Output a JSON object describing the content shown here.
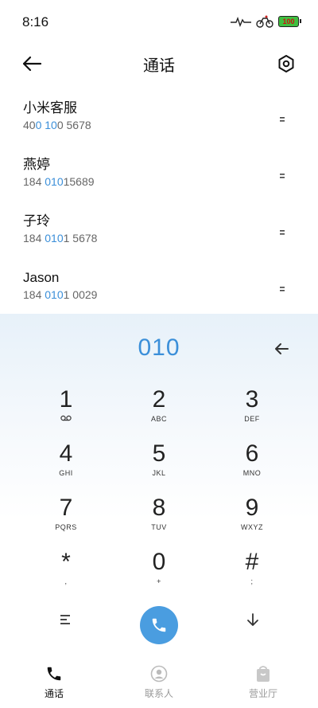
{
  "status_bar": {
    "time": "8:16",
    "battery_level": "100"
  },
  "header": {
    "title": "通话"
  },
  "contacts": [
    {
      "name": "小米客服",
      "number_pre": "40",
      "number_match": "0 10",
      "number_post": "0 5678"
    },
    {
      "name": "燕婷",
      "number_pre": "184 ",
      "number_match": "010",
      "number_post": "15689"
    },
    {
      "name": "子玲",
      "number_pre": "184 ",
      "number_match": "010",
      "number_post": "1 5678"
    },
    {
      "name": "Jason",
      "number_pre": "184 ",
      "number_match": "010",
      "number_post": "1 0029"
    }
  ],
  "dialer": {
    "input": "010",
    "keys": [
      {
        "digit": "1",
        "sub": "voicemail-icon"
      },
      {
        "digit": "2",
        "sub": "ABC"
      },
      {
        "digit": "3",
        "sub": "DEF"
      },
      {
        "digit": "4",
        "sub": "GHI"
      },
      {
        "digit": "5",
        "sub": "JKL"
      },
      {
        "digit": "6",
        "sub": "MNO"
      },
      {
        "digit": "7",
        "sub": "PQRS"
      },
      {
        "digit": "8",
        "sub": "TUV"
      },
      {
        "digit": "9",
        "sub": "WXYZ"
      },
      {
        "digit": "*",
        "sub": ","
      },
      {
        "digit": "0",
        "sub": "+"
      },
      {
        "digit": "#",
        "sub": ";"
      }
    ]
  },
  "bottom_nav": [
    {
      "label": "通话",
      "icon": "phone-icon",
      "active": true
    },
    {
      "label": "联系人",
      "icon": "contacts-icon",
      "active": false
    },
    {
      "label": "营业厅",
      "icon": "store-icon",
      "active": false
    }
  ],
  "colors": {
    "accent": "#3b8fd9",
    "call_button": "#4a9de0"
  }
}
